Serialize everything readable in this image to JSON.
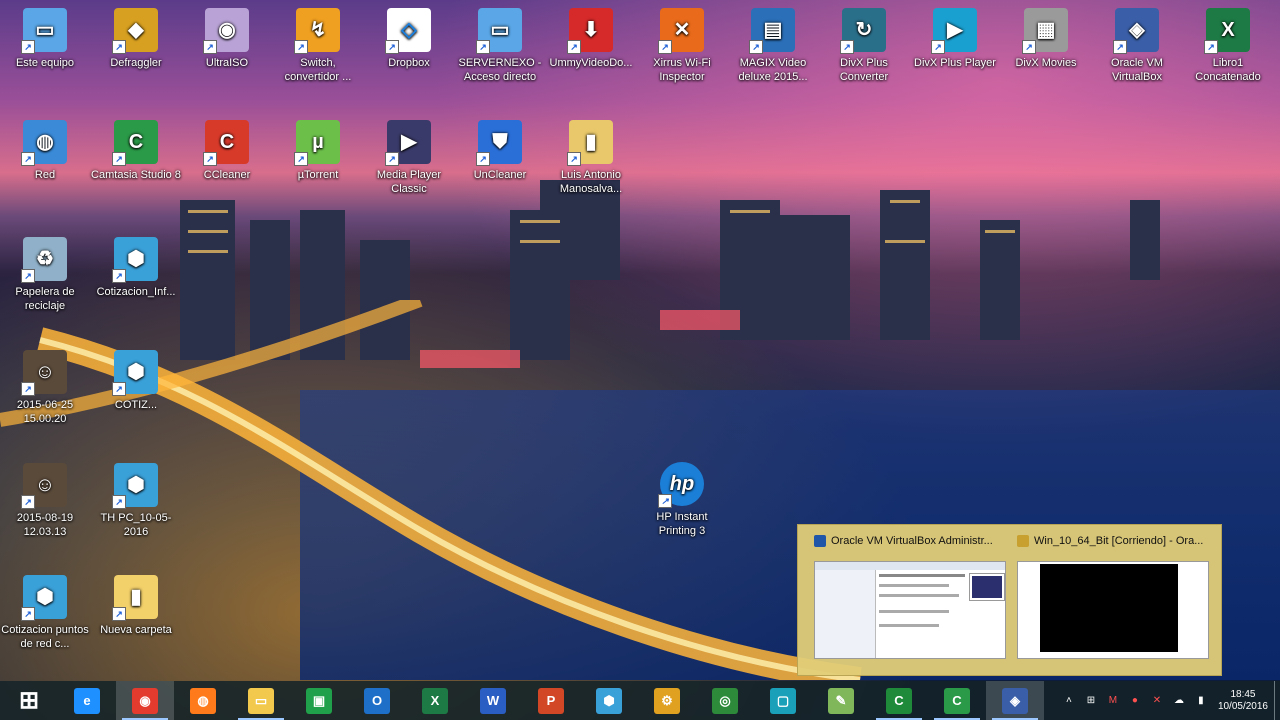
{
  "desktop": {
    "row1": [
      {
        "label": "Este equipo",
        "icon": "computer-icon"
      },
      {
        "label": "Defraggler",
        "icon": "defraggler-icon"
      },
      {
        "label": "UltraISO",
        "icon": "disc-icon"
      },
      {
        "label": "Switch, convertidor ...",
        "icon": "switch-icon"
      },
      {
        "label": "Dropbox",
        "icon": "dropbox-icon"
      },
      {
        "label": "SERVERNEXO - Acceso directo",
        "icon": "server-icon"
      },
      {
        "label": "UmmyVideoDo...",
        "icon": "download-icon"
      },
      {
        "label": "Xirrus Wi-Fi Inspector",
        "icon": "xirrus-icon"
      },
      {
        "label": "MAGIX Video deluxe 2015...",
        "icon": "magix-icon"
      },
      {
        "label": "DivX Plus Converter",
        "icon": "divx-converter-icon"
      },
      {
        "label": "DivX Plus Player",
        "icon": "divx-player-icon"
      },
      {
        "label": "DivX Movies",
        "icon": "divx-movies-icon"
      },
      {
        "label": "Oracle VM VirtualBox",
        "icon": "virtualbox-icon"
      },
      {
        "label": "Libro1 Concatenado",
        "icon": "excel-icon"
      }
    ],
    "row2": [
      {
        "label": "Red",
        "icon": "network-icon"
      },
      {
        "label": "Camtasia Studio 8",
        "icon": "camtasia-icon"
      },
      {
        "label": "CCleaner",
        "icon": "ccleaner-icon"
      },
      {
        "label": "µTorrent",
        "icon": "utorrent-icon"
      },
      {
        "label": "Media Player Classic",
        "icon": "media-player-icon"
      },
      {
        "label": "UnCleaner",
        "icon": "uncleaner-icon"
      },
      {
        "label": "Luis Antonio Manosalva...",
        "icon": "user-folder-icon"
      }
    ],
    "left_column": [
      {
        "label": "Papelera de reciclaje",
        "icon": "recycle-bin-icon"
      },
      {
        "label": "Cotizacion_Inf...",
        "icon": "cotizacion-icon"
      },
      {
        "label": "2015-06-25 15.00.20",
        "icon": "photo-icon"
      },
      {
        "label": "COTIZ...",
        "icon": "cotizacion-icon"
      },
      {
        "label": "2015-08-19 12.03.13",
        "icon": "photo-icon"
      },
      {
        "label": "TH PC_10-05-2016",
        "icon": "cotizacion-icon"
      },
      {
        "label": "Cotizacion puntos de red c...",
        "icon": "cotizacion-icon"
      },
      {
        "label": "Nueva carpeta",
        "icon": "folder-icon"
      }
    ],
    "hp": {
      "label": "HP Instant Printing 3",
      "icon": "hp-icon"
    }
  },
  "thumbnails": [
    {
      "title": "Oracle VM VirtualBox Administr...",
      "icon": "virtualbox-icon"
    },
    {
      "title": "Win_10_64_Bit [Corriendo] - Ora...",
      "icon": "vm-window-icon"
    }
  ],
  "taskbar": {
    "buttons": [
      {
        "name": "start-button",
        "icon": "windows-icon",
        "color": "#ffffff"
      },
      {
        "name": "ie-button",
        "icon": "internet-explorer-icon",
        "color": "#1e90ff"
      },
      {
        "name": "chrome-button",
        "icon": "chrome-icon",
        "color": "#e33b2e"
      },
      {
        "name": "firefox-button",
        "icon": "firefox-icon",
        "color": "#ff7a1a"
      },
      {
        "name": "explorer-button",
        "icon": "file-explorer-icon",
        "color": "#f2c94c"
      },
      {
        "name": "store-button",
        "icon": "store-icon",
        "color": "#20a04a"
      },
      {
        "name": "outlook-button",
        "icon": "outlook-icon",
        "color": "#1e6fc8"
      },
      {
        "name": "excel-button",
        "icon": "excel-icon",
        "color": "#1d7a45"
      },
      {
        "name": "word-button",
        "icon": "word-icon",
        "color": "#2b5ec2"
      },
      {
        "name": "powerpoint-button",
        "icon": "powerpoint-icon",
        "color": "#d24726"
      },
      {
        "name": "cotizacion-button",
        "icon": "cotizacion-icon",
        "color": "#3aa0d8"
      },
      {
        "name": "tools-button",
        "icon": "tools-icon",
        "color": "#e0a020"
      },
      {
        "name": "globe-button",
        "icon": "globe-icon",
        "color": "#2d8a3a"
      },
      {
        "name": "screen-button",
        "icon": "screen-icon",
        "color": "#1aa0b8"
      },
      {
        "name": "editor-button",
        "icon": "editor-icon",
        "color": "#7fb75a"
      },
      {
        "name": "camtasia-recorder-button",
        "icon": "camtasia-recorder-icon",
        "color": "#1e8a3a"
      },
      {
        "name": "camtasia-studio-button",
        "icon": "camtasia-icon",
        "color": "#2a9a48"
      },
      {
        "name": "virtualbox-button",
        "icon": "virtualbox-icon",
        "color": "#3a5fa8"
      }
    ],
    "tray": {
      "icons": [
        "chevron-up-icon",
        "windows-flag-icon",
        "antivirus-icon",
        "red-app-icon",
        "close-box-icon",
        "cloud-icon",
        "network-bars-icon"
      ],
      "time": "18:45",
      "date": "10/05/2016"
    }
  }
}
